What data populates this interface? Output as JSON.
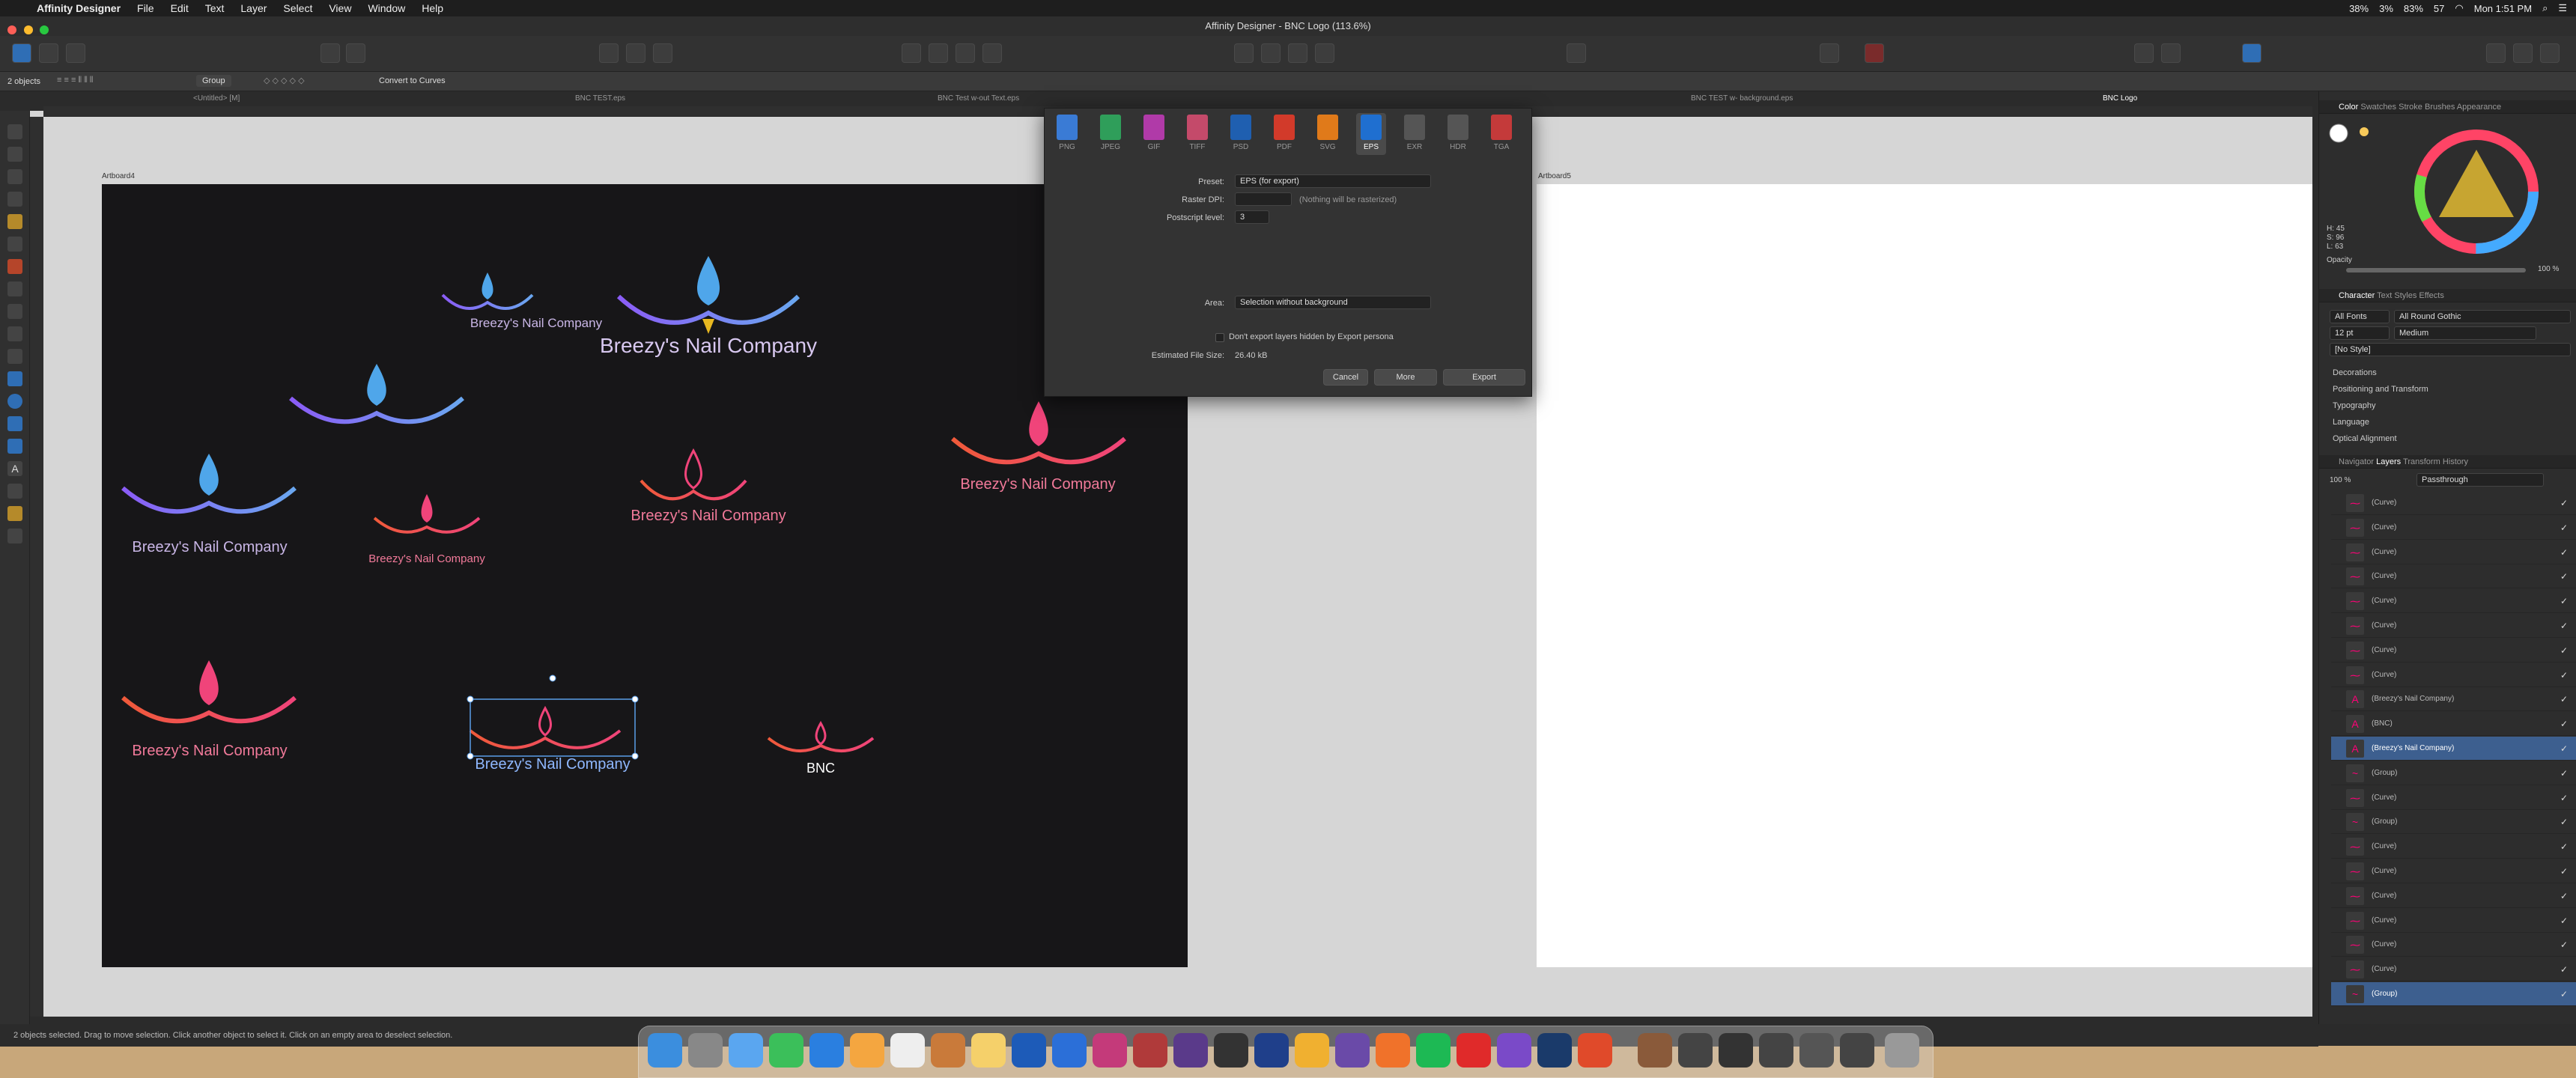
{
  "menubar": {
    "app": "Affinity Designer",
    "items": [
      "File",
      "Edit",
      "Text",
      "Layer",
      "Select",
      "View",
      "Window",
      "Help"
    ],
    "status": {
      "cpu": "38%",
      "mem": "3%",
      "battery": "83%",
      "notif": "57",
      "clock": "Mon 1:51 PM"
    }
  },
  "window": {
    "title": "Affinity Designer - BNC Logo (113.6%)"
  },
  "context": {
    "selection": "2 objects",
    "group_label": "Group",
    "convert_label": "Convert to Curves"
  },
  "tabs": [
    "<Untitled> [M]",
    "BNC TEST.eps",
    "BNC Test w-out Text.eps",
    "BNC TEST w- background.eps",
    "BNC Logo"
  ],
  "canvas": {
    "artboard4": "Artboard4",
    "artboard5": "Artboard5",
    "brand": "Breezy's Nail Company",
    "monogram": "BNC"
  },
  "export_dialog": {
    "formats": [
      "PNG",
      "JPEG",
      "GIF",
      "TIFF",
      "PSD",
      "PDF",
      "SVG",
      "EPS",
      "EXR",
      "HDR",
      "TGA"
    ],
    "selected_format": "EPS",
    "preset_label": "Preset:",
    "preset_value": "EPS (for export)",
    "raster_label": "Raster DPI:",
    "raster_note": "(Nothing will be rasterized)",
    "ps_label": "Postscript level:",
    "ps_value": "3",
    "area_label": "Area:",
    "area_value": "Selection without background",
    "hidden_label": "Don't export layers hidden by Export persona",
    "size_label": "Estimated File Size:",
    "size_value": "26.40 kB",
    "cancel": "Cancel",
    "more": "More",
    "export": "Export"
  },
  "panels": {
    "color_tabs": [
      "Color",
      "Swatches",
      "Stroke",
      "Brushes",
      "Appearance"
    ],
    "hsl": {
      "h": "H: 45",
      "s": "S: 96",
      "l": "L: 63"
    },
    "opacity_label": "Opacity",
    "opacity_value": "100 %",
    "char_tabs": [
      "Character",
      "Text Styles",
      "Effects"
    ],
    "font_group": "All Fonts",
    "font": "All Round Gothic",
    "size": "12 pt",
    "weight": "Medium",
    "style": "[No Style]",
    "sections": [
      "Decorations",
      "Positioning and Transform",
      "Typography",
      "Language",
      "Optical Alignment"
    ],
    "layer_tabs": [
      "Navigator",
      "Layers",
      "Transform",
      "History"
    ],
    "layer_opacity": "100 %",
    "blend": "Passthrough",
    "layers": [
      "(Curve)",
      "(Curve)",
      "(Curve)",
      "(Curve)",
      "(Curve)",
      "(Curve)",
      "(Curve)",
      "(Curve)",
      "(Breezy's Nail Company)",
      "(BNC)",
      "(Breezy's Nail Company)",
      "(Group)",
      "(Curve)",
      "(Group)",
      "(Curve)",
      "(Curve)",
      "(Curve)",
      "(Curve)",
      "(Curve)",
      "(Curve)",
      "(Group)"
    ],
    "selected_layers": [
      10,
      20
    ]
  },
  "statusbar": {
    "text": "2 objects selected. Drag to move selection. Click another object to select it. Click on an empty area to deselect selection."
  },
  "colors": {
    "accent": "#3d5f8f",
    "pink": "#f0447a",
    "purple": "#7a5fd6",
    "blue": "#4fa6ea"
  }
}
